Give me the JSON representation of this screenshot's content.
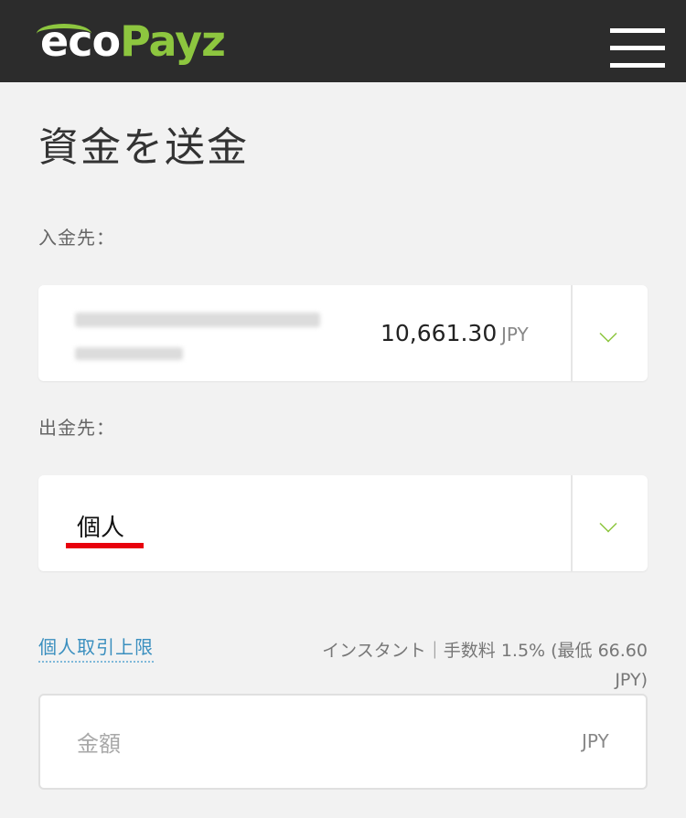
{
  "header": {
    "logo_eco": "eco",
    "logo_payz": "Payz",
    "menu_icon": "hamburger-menu-icon"
  },
  "title": "資金を送金",
  "deposit_to": {
    "label": "入金先：",
    "balance": "10,661.30",
    "currency": "JPY"
  },
  "withdraw_from": {
    "label": "出金先：",
    "value": "個人"
  },
  "limit_link": "個人取引上限",
  "fee_line1": "インスタント｜手数料 1.5% (最低 66.60",
  "fee_line2": "JPY)",
  "amount": {
    "placeholder": "金額",
    "currency": "JPY",
    "value": ""
  },
  "colors": {
    "header_bg": "#2c2c2c",
    "brand_green": "#8dc63f",
    "link_blue": "#3a8fbf",
    "highlight_red": "#e8000d"
  }
}
